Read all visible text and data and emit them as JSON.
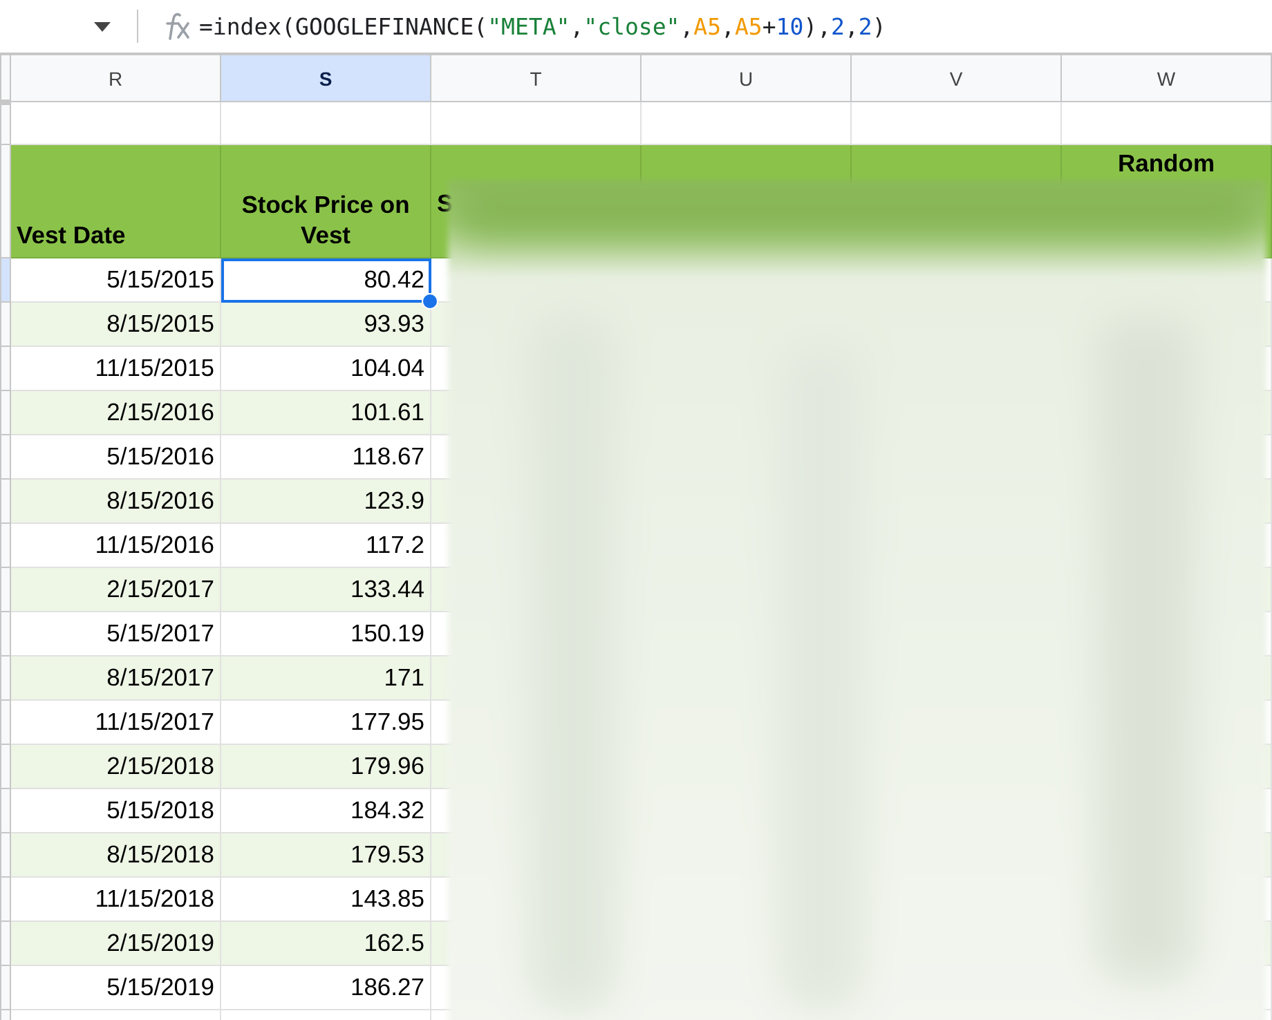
{
  "formula_bar": {
    "formula": [
      {
        "kind": "text",
        "text": "=index(GOOGLEFINANCE("
      },
      {
        "kind": "string",
        "text": "\"META\""
      },
      {
        "kind": "text",
        "text": ","
      },
      {
        "kind": "string",
        "text": "\"close\""
      },
      {
        "kind": "text",
        "text": ","
      },
      {
        "kind": "ref",
        "text": "A5"
      },
      {
        "kind": "text",
        "text": ","
      },
      {
        "kind": "ref",
        "text": "A5"
      },
      {
        "kind": "text",
        "text": "+"
      },
      {
        "kind": "number",
        "text": "10"
      },
      {
        "kind": "text",
        "text": "),"
      },
      {
        "kind": "number",
        "text": "2"
      },
      {
        "kind": "text",
        "text": ","
      },
      {
        "kind": "number",
        "text": "2"
      },
      {
        "kind": "text",
        "text": ")"
      }
    ]
  },
  "columns": [
    {
      "label": "R",
      "header": "Vest Date",
      "selected": false
    },
    {
      "label": "S",
      "header": "Stock Price on Vest",
      "selected": true
    },
    {
      "label": "T",
      "header": "S",
      "selected": false
    },
    {
      "label": "U",
      "selected": false
    },
    {
      "label": "V",
      "selected": false
    },
    {
      "label": "W",
      "header": "Random",
      "selected": false
    }
  ],
  "rows": [
    {
      "vest_date": "5/15/2015",
      "price": "80.42",
      "selected": true
    },
    {
      "vest_date": "8/15/2015",
      "price": "93.93",
      "selected": false
    },
    {
      "vest_date": "11/15/2015",
      "price": "104.04",
      "selected": false
    },
    {
      "vest_date": "2/15/2016",
      "price": "101.61",
      "selected": false
    },
    {
      "vest_date": "5/15/2016",
      "price": "118.67",
      "selected": false
    },
    {
      "vest_date": "8/15/2016",
      "price": "123.9",
      "selected": false
    },
    {
      "vest_date": "11/15/2016",
      "price": "117.2",
      "selected": false
    },
    {
      "vest_date": "2/15/2017",
      "price": "133.44",
      "selected": false
    },
    {
      "vest_date": "5/15/2017",
      "price": "150.19",
      "selected": false
    },
    {
      "vest_date": "8/15/2017",
      "price": "171",
      "selected": false
    },
    {
      "vest_date": "11/15/2017",
      "price": "177.95",
      "selected": false
    },
    {
      "vest_date": "2/15/2018",
      "price": "179.96",
      "selected": false
    },
    {
      "vest_date": "5/15/2018",
      "price": "184.32",
      "selected": false
    },
    {
      "vest_date": "8/15/2018",
      "price": "179.53",
      "selected": false
    },
    {
      "vest_date": "11/15/2018",
      "price": "143.85",
      "selected": false
    },
    {
      "vest_date": "2/15/2019",
      "price": "162.5",
      "selected": false
    },
    {
      "vest_date": "5/15/2019",
      "price": "186.27",
      "selected": false
    }
  ]
}
